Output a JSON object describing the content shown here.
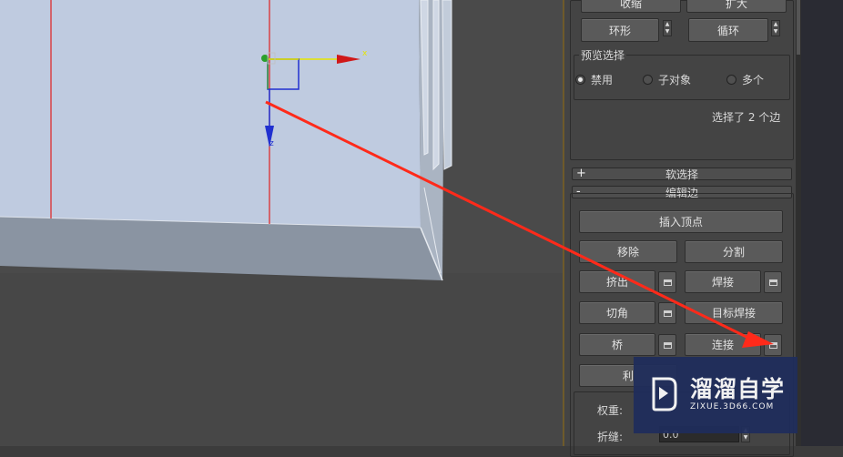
{
  "panel": {
    "top_buttons": {
      "shrink": "收缩",
      "grow": "扩大",
      "ring": "环形",
      "loop": "循环"
    },
    "preview_selection": {
      "title": "预览选择",
      "options": [
        "禁用",
        "子对象",
        "多个"
      ],
      "selected": "禁用"
    },
    "selection_status": "选择了 2 个边",
    "rollouts": {
      "soft_selection": {
        "label": "软选择",
        "sign": "+"
      },
      "edit_edges": {
        "label": "编辑边",
        "sign": "-"
      }
    },
    "edit_edges": {
      "insert_vertex": "插入顶点",
      "remove": "移除",
      "split": "分割",
      "extrude": "挤出",
      "weld": "焊接",
      "chamfer": "切角",
      "target_weld": "目标焊接",
      "bridge": "桥",
      "connect": "连接",
      "partial_button": "利"
    },
    "properties": {
      "weight_label": "权重:",
      "crease_label": "折缝:",
      "crease_value": "0.0"
    }
  },
  "viewport": {
    "gizmo": {
      "x_label": "x",
      "z_label": "z"
    }
  },
  "watermark": {
    "title": "溜溜自学",
    "url": "ZIXUE.3D66.COM"
  },
  "colors": {
    "annotation_arrow": "#ff2a1a",
    "viewport_bg": "#4a4a4a",
    "model_face": "#bfcbe0",
    "watermark_bg": "#1f2d5c"
  }
}
